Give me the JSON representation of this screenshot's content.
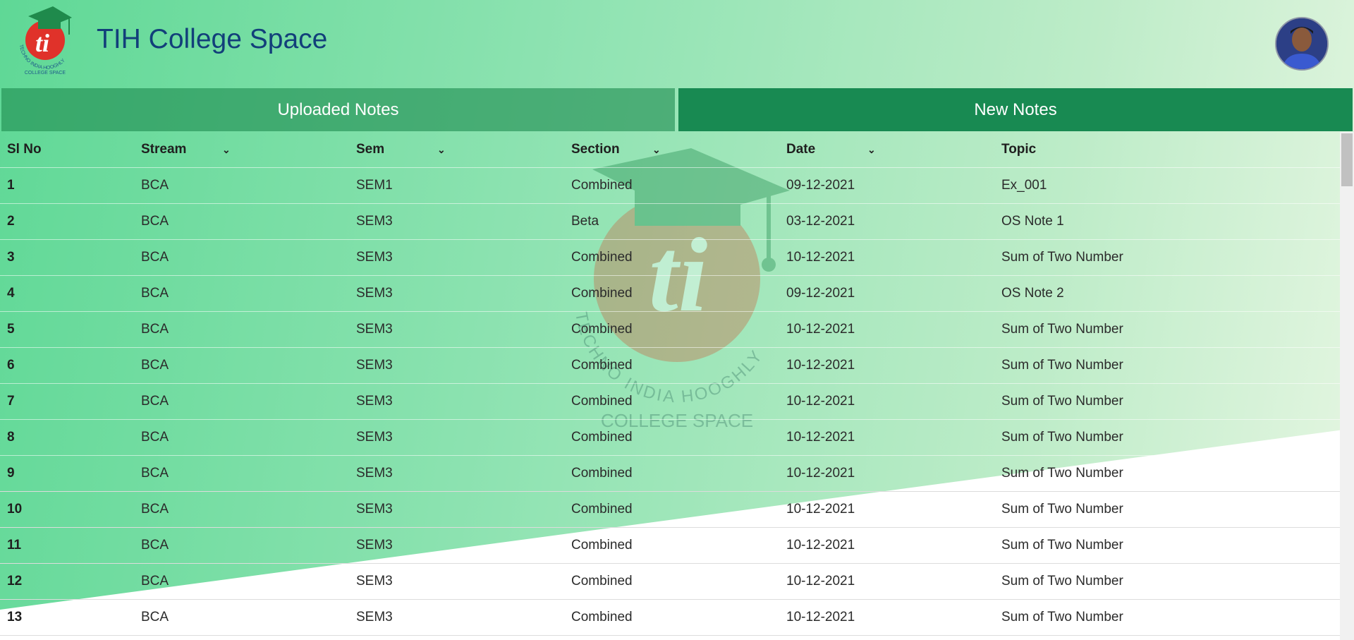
{
  "app": {
    "title": "TIH College Space",
    "logo_text_top": "TECHNO INDIA HOOGHLY",
    "logo_text_bottom": "COLLEGE SPACE"
  },
  "tabs": [
    {
      "label": "Uploaded Notes"
    },
    {
      "label": "New Notes"
    }
  ],
  "table": {
    "headers": {
      "sl_no": "Sl No",
      "stream": "Stream",
      "sem": "Sem",
      "section": "Section",
      "date": "Date",
      "topic": "Topic"
    },
    "rows": [
      {
        "sl": "1",
        "stream": "BCA",
        "sem": "SEM1",
        "section": "Combined",
        "date": "09-12-2021",
        "topic": "Ex_001"
      },
      {
        "sl": "2",
        "stream": "BCA",
        "sem": "SEM3",
        "section": "Beta",
        "date": "03-12-2021",
        "topic": "OS Note 1"
      },
      {
        "sl": "3",
        "stream": "BCA",
        "sem": "SEM3",
        "section": "Combined",
        "date": "10-12-2021",
        "topic": "Sum of Two Number"
      },
      {
        "sl": "4",
        "stream": "BCA",
        "sem": "SEM3",
        "section": "Combined",
        "date": "09-12-2021",
        "topic": "OS Note 2"
      },
      {
        "sl": "5",
        "stream": "BCA",
        "sem": "SEM3",
        "section": "Combined",
        "date": "10-12-2021",
        "topic": "Sum of Two Number"
      },
      {
        "sl": "6",
        "stream": "BCA",
        "sem": "SEM3",
        "section": "Combined",
        "date": "10-12-2021",
        "topic": "Sum of Two Number"
      },
      {
        "sl": "7",
        "stream": "BCA",
        "sem": "SEM3",
        "section": "Combined",
        "date": "10-12-2021",
        "topic": "Sum of Two Number"
      },
      {
        "sl": "8",
        "stream": "BCA",
        "sem": "SEM3",
        "section": "Combined",
        "date": "10-12-2021",
        "topic": "Sum of Two Number"
      },
      {
        "sl": "9",
        "stream": "BCA",
        "sem": "SEM3",
        "section": "Combined",
        "date": "10-12-2021",
        "topic": "Sum of Two Number"
      },
      {
        "sl": "10",
        "stream": "BCA",
        "sem": "SEM3",
        "section": "Combined",
        "date": "10-12-2021",
        "topic": "Sum of Two Number"
      },
      {
        "sl": "11",
        "stream": "BCA",
        "sem": "SEM3",
        "section": "Combined",
        "date": "10-12-2021",
        "topic": "Sum of Two Number"
      },
      {
        "sl": "12",
        "stream": "BCA",
        "sem": "SEM3",
        "section": "Combined",
        "date": "10-12-2021",
        "topic": "Sum of Two Number"
      },
      {
        "sl": "13",
        "stream": "BCA",
        "sem": "SEM3",
        "section": "Combined",
        "date": "10-12-2021",
        "topic": "Sum of Two Number"
      }
    ]
  },
  "icons": {
    "dropdown": "chevron-down-icon",
    "avatar": "user-avatar"
  },
  "colors": {
    "title": "#123f7a",
    "active_tab": "#188a52",
    "inactive_tab": "#4fab78",
    "logo_red": "#e0322a",
    "logo_green": "#1f8a4c"
  }
}
